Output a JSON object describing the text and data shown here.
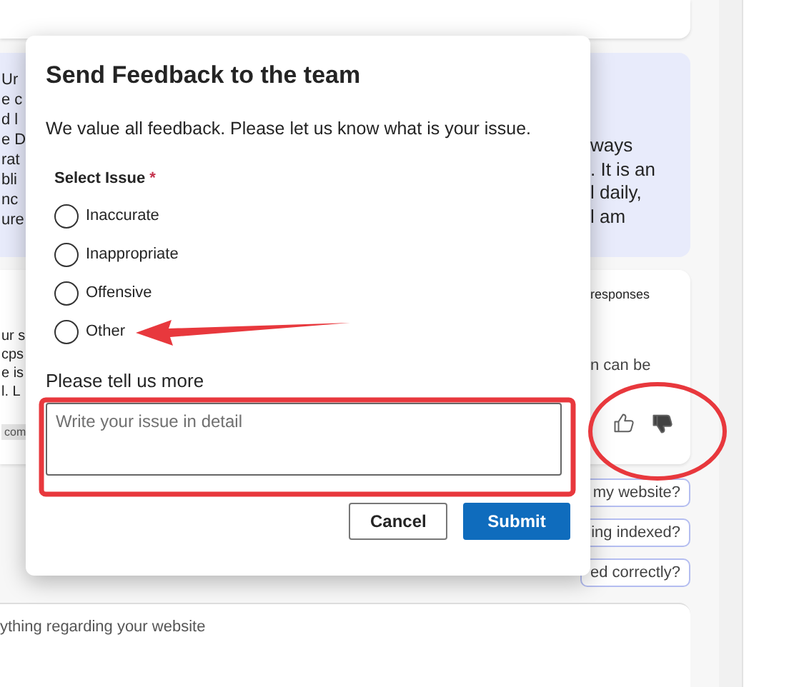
{
  "chat": {
    "bubble_left": [
      "Ur",
      "e c",
      "d l",
      "e D",
      "rat",
      "bli",
      "nc",
      "ure"
    ],
    "bubble_right": [
      "ways",
      ". It is an",
      "l daily,",
      "l am"
    ],
    "answer_left": [
      "ur s",
      "cps",
      "e is",
      "l. L"
    ],
    "answer_chip": "com",
    "responses": "responses",
    "answer_right": "n can be",
    "feedback": [
      {
        "kind": "like",
        "selected": false
      },
      {
        "kind": "dislike",
        "selected": true
      }
    ],
    "suggestions": [
      "my website?",
      "ing indexed?",
      "ed correctly?"
    ],
    "input_placeholder": "ything regarding your website"
  },
  "dialog": {
    "title": "Send Feedback to the team",
    "description": "We value all feedback. Please let us know what is your issue.",
    "select_label": "Select Issue",
    "required_mark": "*",
    "options": [
      {
        "label": "Inaccurate",
        "selected": false
      },
      {
        "label": "Inappropriate",
        "selected": false
      },
      {
        "label": "Offensive",
        "selected": false
      },
      {
        "label": "Other",
        "selected": false
      }
    ],
    "details_label": "Please tell us more",
    "details_placeholder": "Write your issue in detail",
    "buttons": [
      {
        "label": "Cancel",
        "kind": "secondary"
      },
      {
        "label": "Submit",
        "kind": "primary"
      }
    ]
  }
}
